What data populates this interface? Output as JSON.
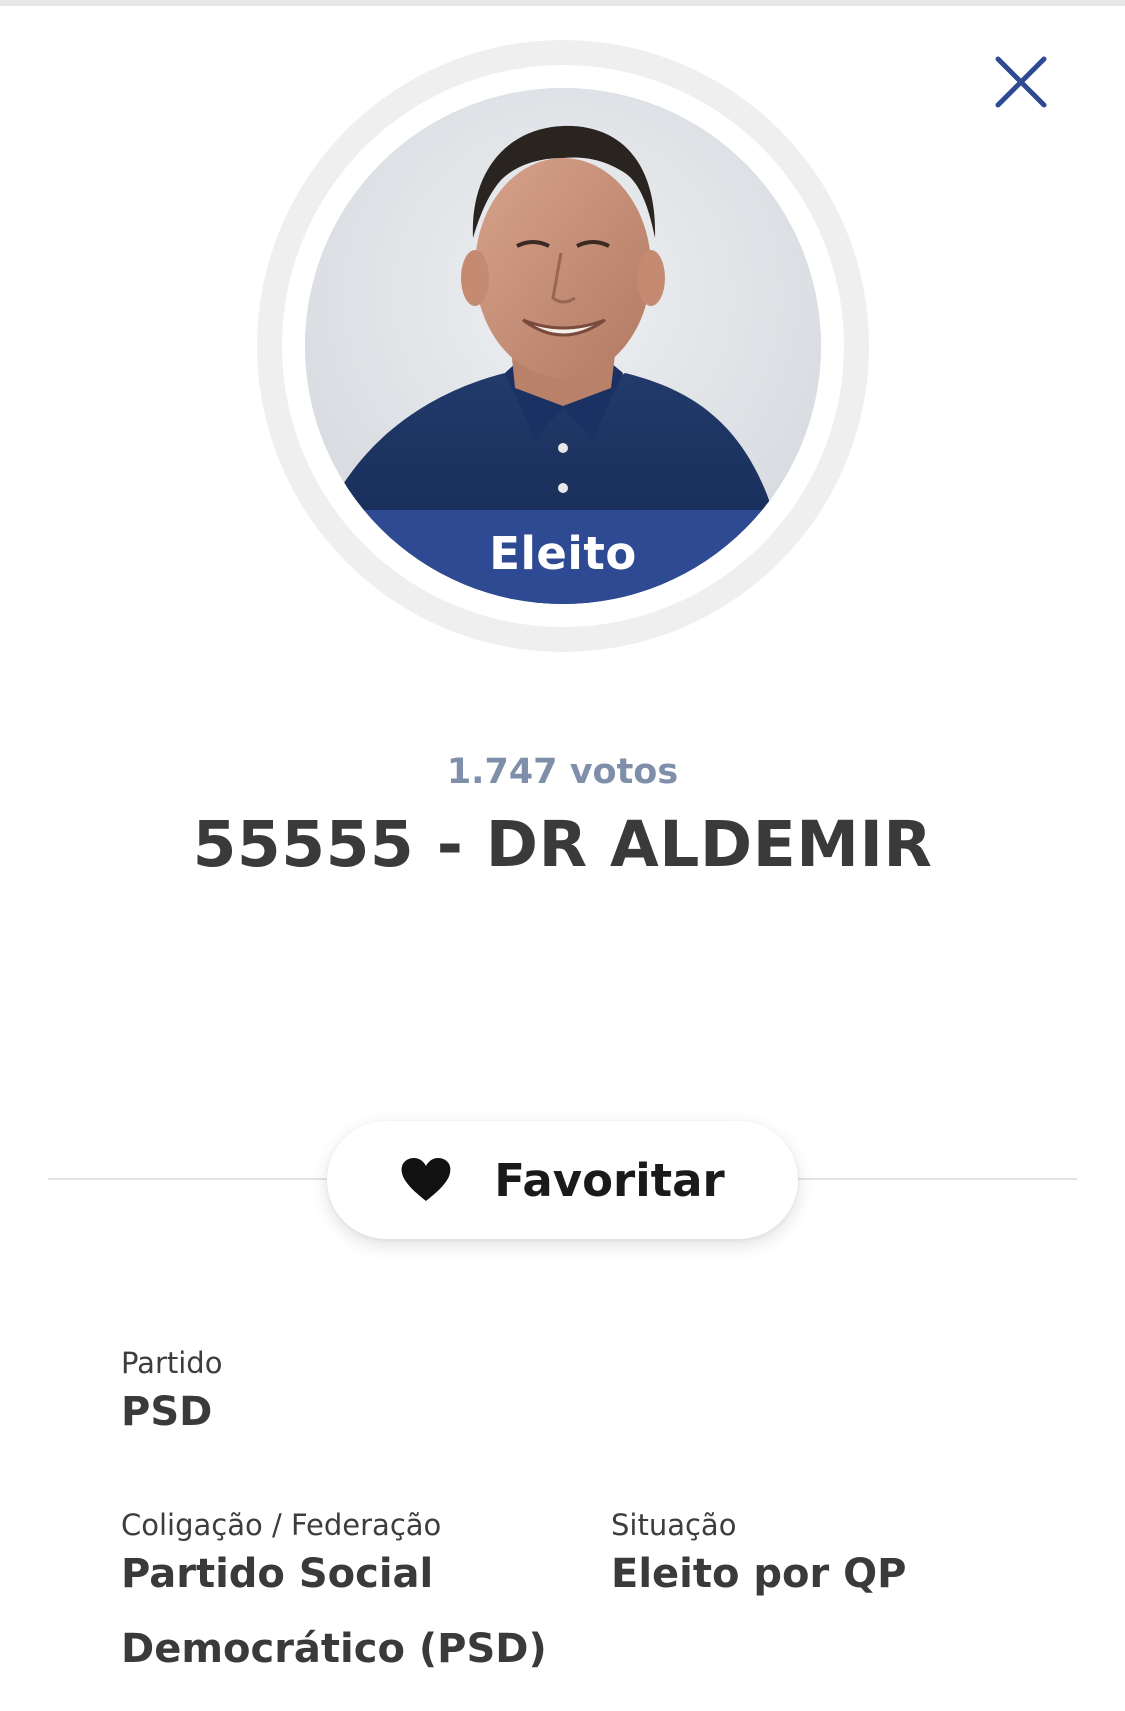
{
  "modal": {
    "close_label": "close",
    "icon": "close-icon"
  },
  "candidate": {
    "status_badge": "Eleito",
    "votes_text": "1.747 votos",
    "name_line": "55555 - DR ALDEMIR",
    "photo_icon": "candidate-photo"
  },
  "actions": {
    "favorite_label": "Favoritar",
    "favorite_icon": "heart-icon"
  },
  "details": {
    "party": {
      "label": "Partido",
      "value": "PSD"
    },
    "coalition": {
      "label": "Coligação / Federação",
      "value_line1": "Partido Social",
      "value_line2": "Democrático (PSD)"
    },
    "situation": {
      "label": "Situação",
      "value": "Eleito por QP"
    }
  },
  "colors": {
    "accent_blue": "#2e4a93",
    "votes_gray_blue": "#7f8fa9",
    "text_dark": "#3a3a3a"
  }
}
